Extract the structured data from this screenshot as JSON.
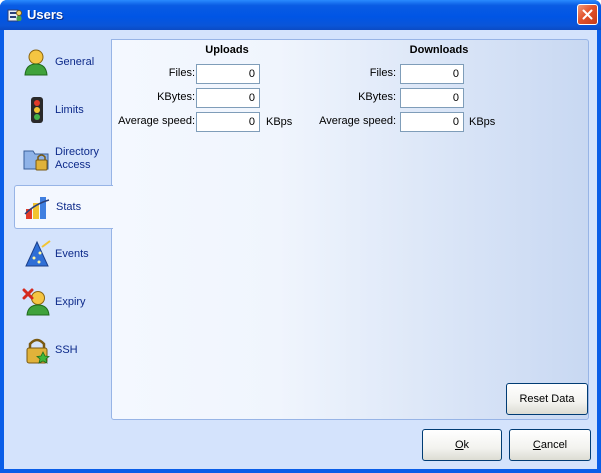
{
  "window": {
    "title": "Users",
    "title_icon": "users-window-icon",
    "close_icon": "close-icon"
  },
  "sidebar": {
    "items": [
      {
        "label": "General",
        "icon": "user-icon",
        "active": false
      },
      {
        "label": "Limits",
        "icon": "traffic-light-icon",
        "active": false
      },
      {
        "label": "Directory Access",
        "label_line1": "Directory",
        "label_line2": "Access",
        "icon": "folder-lock-icon",
        "active": false
      },
      {
        "label": "Stats",
        "icon": "bar-chart-icon",
        "active": true
      },
      {
        "label": "Events",
        "icon": "wizard-hat-icon",
        "active": false
      },
      {
        "label": "Expiry",
        "icon": "user-expired-icon",
        "active": false
      },
      {
        "label": "SSH",
        "icon": "padlock-star-icon",
        "active": false
      }
    ]
  },
  "stats": {
    "uploads": {
      "heading": "Uploads",
      "files_label": "Files:",
      "files_value": "0",
      "kbytes_label": "KBytes:",
      "kbytes_value": "0",
      "speed_label": "Average speed:",
      "speed_value": "0",
      "speed_unit": "KBps"
    },
    "downloads": {
      "heading": "Downloads",
      "files_label": "Files:",
      "files_value": "0",
      "kbytes_label": "KBytes:",
      "kbytes_value": "0",
      "speed_label": "Average speed:",
      "speed_value": "0",
      "speed_unit": "KBps"
    },
    "reset_label": "Reset Data"
  },
  "footer": {
    "ok_label": "Ok",
    "ok_accel": "O",
    "ok_rest": "k",
    "cancel_label": "Cancel",
    "cancel_accel": "C",
    "cancel_rest": "ancel"
  },
  "colors": {
    "titlebar": "#0055e5",
    "client": "#d4e3fc",
    "accent_text": "#0d2a8a",
    "close": "#e2532c"
  }
}
